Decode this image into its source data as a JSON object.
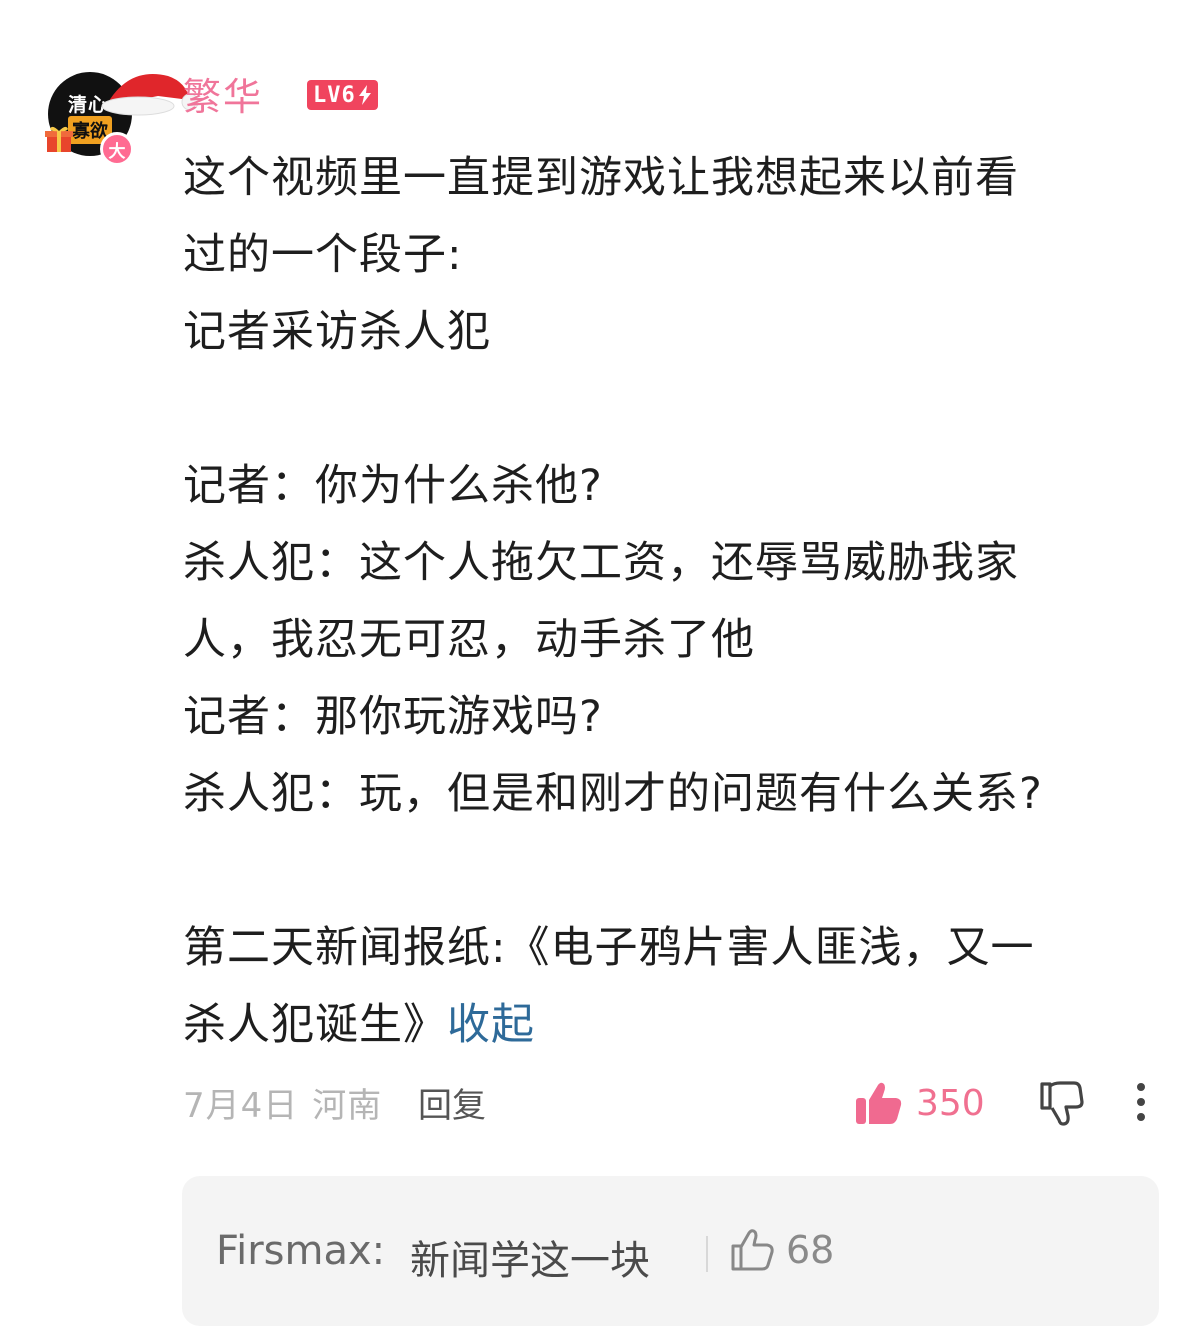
{
  "comment": {
    "avatar": {
      "text_line1": "清心",
      "text_line2": "寡欲",
      "badge": "大"
    },
    "username": "繁华",
    "level": "LV6",
    "body_lines": [
      "这个视频里一直提到游戏让我想起来以前看",
      "过的一个段子:",
      "记者采访杀人犯",
      "",
      "记者：你为什么杀他?",
      "杀人犯：这个人拖欠工资，还辱骂威胁我家",
      "人，我忍无可忍，动手杀了他",
      "记者：那你玩游戏吗?",
      "杀人犯：玩，但是和刚才的问题有什么关系?",
      "",
      "第二天新闻报纸:《电子鸦片害人匪浅，又一",
      "杀人犯诞生》"
    ],
    "collapse_label": "收起",
    "date": "7月4日",
    "location": "河南",
    "reply_label": "回复",
    "like_count": "350",
    "colors": {
      "username": "#f0759a",
      "level_badge": "#f0445e",
      "link": "#2e6a99",
      "like": "#f07090"
    }
  },
  "reply_preview": {
    "author": "Firsmax:",
    "text": "新闻学这一块",
    "like_count": "68"
  }
}
